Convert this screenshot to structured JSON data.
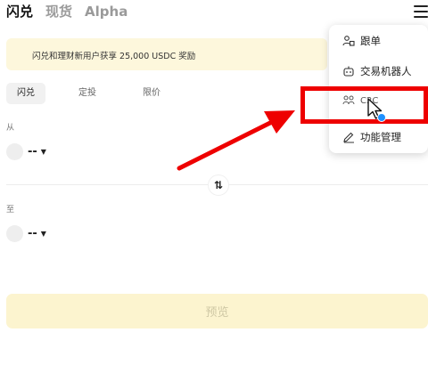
{
  "header": {
    "tabs": [
      {
        "label": "闪兑",
        "active": true
      },
      {
        "label": "现货",
        "active": false
      },
      {
        "label": "Alpha",
        "active": false
      }
    ],
    "menu_icon": "hamburger-menu-icon"
  },
  "promo": {
    "text": "闪兑和理财新用户获享 25,000 USDC 奖励"
  },
  "order_tabs": [
    {
      "label": "闪兑",
      "active": true
    },
    {
      "label": "定投",
      "active": false
    },
    {
      "label": "限价",
      "active": false
    }
  ],
  "from": {
    "label": "从",
    "token": "--"
  },
  "to": {
    "label": "至",
    "token": "--"
  },
  "swap_icon": "swap-arrows-icon",
  "preview_button": {
    "label": "预览"
  },
  "dropdown_menu": {
    "items": [
      {
        "label": "跟单",
        "icon": "copy-trading-icon"
      },
      {
        "label": "交易机器人",
        "icon": "robot-icon"
      },
      {
        "label": "C2C",
        "icon": "c2c-users-icon"
      },
      {
        "label": "功能管理",
        "icon": "edit-pencil-icon"
      }
    ]
  },
  "colors": {
    "highlight": "#ee0000",
    "promo_bg": "#fdf7dc",
    "preview_bg": "#fcf4cf",
    "cursor_dot": "#1e90ff"
  }
}
